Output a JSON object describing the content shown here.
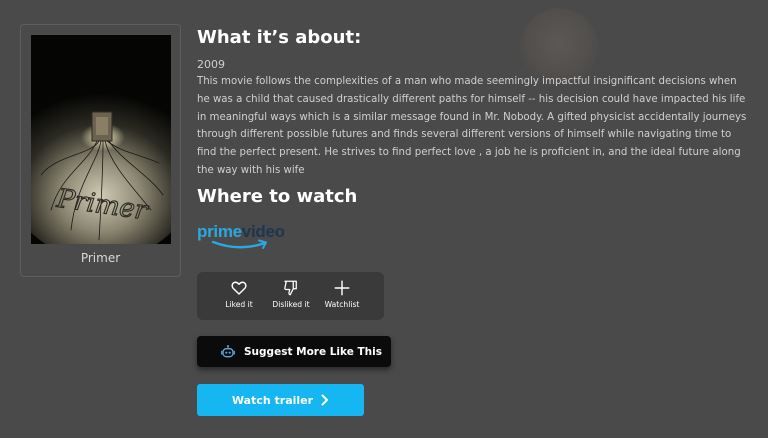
{
  "movie": {
    "poster_title": "Primer",
    "poster_art_text": "Primer",
    "year": "2009",
    "description": "This movie follows the complexities of a man who made seemingly impactful insignificant decisions when he was a child that caused drastically different paths for himself -- his decision could have impacted his life in meaningful ways which is a similar message found in Mr. Nobody. A gifted physicist accidentally journeys through different possible futures and finds several different versions of himself while navigating time to find the perfect present. He strives to find perfect love , a job he is proficient in, and the ideal future along the way with his wife"
  },
  "sections": {
    "about_title": "What it’s about:",
    "watch_title": "Where to watch"
  },
  "streaming": {
    "provider_word_1": "prime",
    "provider_word_2": "video",
    "icon": "prime-video-logo",
    "colors": {
      "prime": "#2aa8e0",
      "video": "#1f3550"
    }
  },
  "actions": [
    {
      "label": "Liked it",
      "icon": "heart-icon"
    },
    {
      "label": "Disliked it",
      "icon": "thumbs-down-icon"
    },
    {
      "label": "Watchlist",
      "icon": "plus-icon"
    }
  ],
  "suggest_button": {
    "label": "Suggest More Like This",
    "icon": "robot-icon"
  },
  "trailer_button": {
    "label": "Watch trailer",
    "icon": "chevron-right-icon"
  },
  "colors": {
    "background": "#4a4a4a",
    "trailer_button": "#16b6f2",
    "suggest_button": "#0b0b0b",
    "action_panel": "#3a3a3a"
  }
}
